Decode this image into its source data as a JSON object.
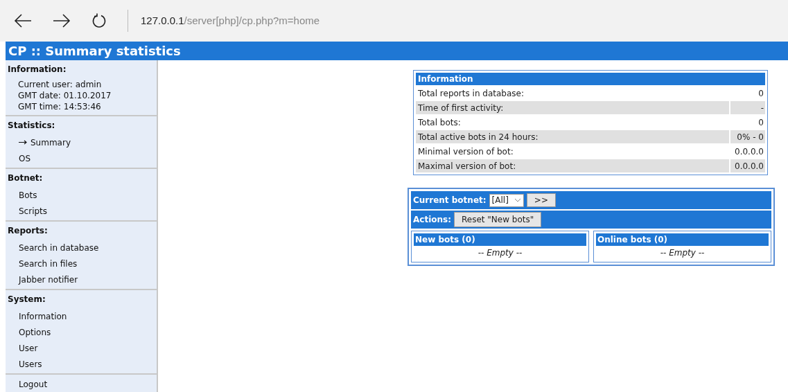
{
  "browser": {
    "url_host": "127.0.0.1",
    "url_path": "/server[php]/cp.php?m=home"
  },
  "title": "CP :: Summary statistics",
  "sidebar": {
    "sections": [
      {
        "heading": "Information:",
        "kind": "info",
        "lines": [
          "Current user: admin",
          "GMT date: 01.10.2017",
          "GMT time: 14:53:46"
        ]
      },
      {
        "heading": "Statistics:",
        "kind": "menu",
        "items": [
          {
            "label": "Summary",
            "selected": true
          },
          {
            "label": "OS",
            "selected": false
          }
        ]
      },
      {
        "heading": "Botnet:",
        "kind": "menu",
        "items": [
          {
            "label": "Bots",
            "selected": false
          },
          {
            "label": "Scripts",
            "selected": false
          }
        ]
      },
      {
        "heading": "Reports:",
        "kind": "menu",
        "items": [
          {
            "label": "Search in database",
            "selected": false
          },
          {
            "label": "Search in files",
            "selected": false
          },
          {
            "label": "Jabber notifier",
            "selected": false
          }
        ]
      },
      {
        "heading": "System:",
        "kind": "menu",
        "items": [
          {
            "label": "Information",
            "selected": false
          },
          {
            "label": "Options",
            "selected": false
          },
          {
            "label": "User",
            "selected": false
          },
          {
            "label": "Users",
            "selected": false
          }
        ]
      },
      {
        "kind": "menu",
        "items": [
          {
            "label": "Logout",
            "selected": false
          }
        ]
      }
    ]
  },
  "info_table": {
    "title": "Information",
    "rows": [
      {
        "label": "Total reports in database:",
        "value": "0"
      },
      {
        "label": "Time of first activity:",
        "value": "-"
      },
      {
        "label": "Total bots:",
        "value": "0"
      },
      {
        "label": "Total active bots in 24 hours:",
        "value": "0% - 0"
      },
      {
        "label": "Minimal version of bot:",
        "value": "0.0.0.0"
      },
      {
        "label": "Maximal version of bot:",
        "value": "0.0.0.0"
      }
    ]
  },
  "botnet": {
    "current_label": "Current botnet:",
    "select_value": "[All]",
    "go_button": ">>",
    "actions_label": "Actions:",
    "reset_button": "Reset \"New bots\"",
    "panels": [
      {
        "title": "New bots (0)",
        "empty": "-- Empty --"
      },
      {
        "title": "Online bots (0)",
        "empty": "-- Empty --"
      }
    ]
  }
}
